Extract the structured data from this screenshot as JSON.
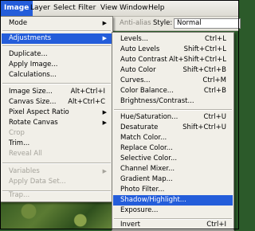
{
  "menubar": {
    "items": [
      "Image",
      "Layer",
      "Select",
      "Filter",
      "View",
      "Window",
      "Help"
    ]
  },
  "options_bar": {
    "antialias_label": "Anti-alias",
    "style_label": "Style:",
    "style_value": "Normal"
  },
  "image_menu": {
    "items": [
      {
        "label": "Mode",
        "submenu": true
      },
      {
        "label": "Adjustments",
        "submenu": true
      },
      {
        "label": "Duplicate..."
      },
      {
        "label": "Apply Image..."
      },
      {
        "label": "Calculations..."
      },
      {
        "label": "Image Size...",
        "shortcut": "Alt+Ctrl+I"
      },
      {
        "label": "Canvas Size...",
        "shortcut": "Alt+Ctrl+C"
      },
      {
        "label": "Pixel Aspect Ratio",
        "submenu": true
      },
      {
        "label": "Rotate Canvas",
        "submenu": true
      },
      {
        "label": "Crop",
        "disabled": true
      },
      {
        "label": "Trim..."
      },
      {
        "label": "Reveal All",
        "disabled": true
      },
      {
        "label": "Variables",
        "submenu": true,
        "disabled": true
      },
      {
        "label": "Apply Data Set...",
        "disabled": true
      },
      {
        "label": "Trap...",
        "disabled": true
      }
    ]
  },
  "adjustments_menu": {
    "items": [
      {
        "label": "Levels...",
        "shortcut": "Ctrl+L"
      },
      {
        "label": "Auto Levels",
        "shortcut": "Shift+Ctrl+L"
      },
      {
        "label": "Auto Contrast",
        "shortcut": "Alt+Shift+Ctrl+L"
      },
      {
        "label": "Auto Color",
        "shortcut": "Shift+Ctrl+B"
      },
      {
        "label": "Curves...",
        "shortcut": "Ctrl+M"
      },
      {
        "label": "Color Balance...",
        "shortcut": "Ctrl+B"
      },
      {
        "label": "Brightness/Contrast..."
      },
      {
        "label": "Hue/Saturation...",
        "shortcut": "Ctrl+U"
      },
      {
        "label": "Desaturate",
        "shortcut": "Shift+Ctrl+U"
      },
      {
        "label": "Match Color..."
      },
      {
        "label": "Replace Color..."
      },
      {
        "label": "Selective Color..."
      },
      {
        "label": "Channel Mixer..."
      },
      {
        "label": "Gradient Map..."
      },
      {
        "label": "Photo Filter..."
      },
      {
        "label": "Shadow/Highlight..."
      },
      {
        "label": "Exposure..."
      },
      {
        "label": "Invert",
        "shortcut": "Ctrl+I"
      }
    ]
  },
  "colors": {
    "highlight": "#245dda",
    "menu_bg": "#f1efe8",
    "disabled_text": "#a5a39b"
  }
}
